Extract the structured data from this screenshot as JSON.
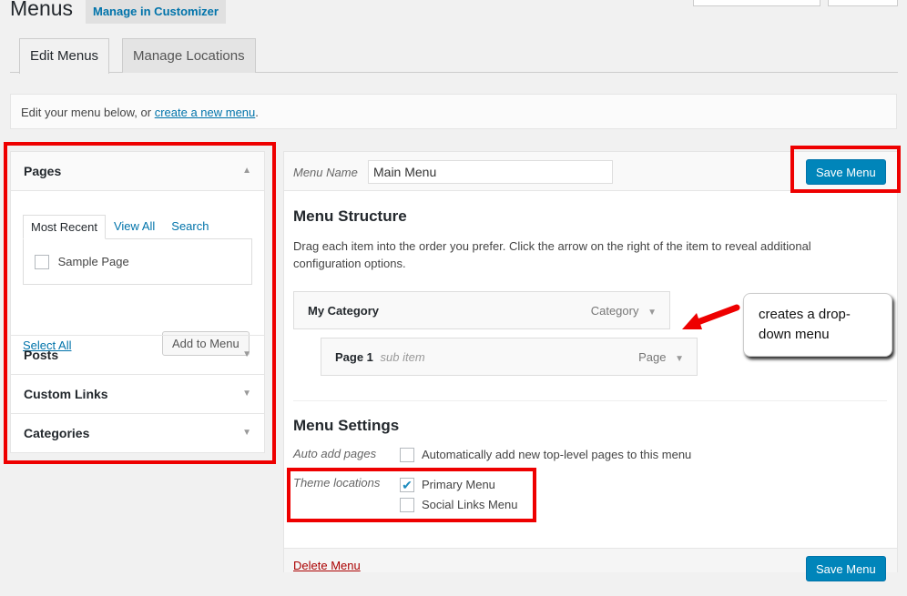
{
  "header": {
    "title": "Menus",
    "customizer_label": "Manage in Customizer"
  },
  "tabs": [
    {
      "label": "Edit Menus",
      "active": true
    },
    {
      "label": "Manage Locations",
      "active": false
    }
  ],
  "notice": {
    "text": "Edit your menu below, or ",
    "link": "create a new menu",
    "end": "."
  },
  "sidebar": {
    "pages": {
      "title": "Pages",
      "tabs": [
        "Most Recent",
        "View All",
        "Search"
      ],
      "items": [
        {
          "label": "Sample Page",
          "checked": false
        }
      ],
      "select_all": "Select All",
      "add_button": "Add to Menu"
    },
    "sections": [
      "Posts",
      "Custom Links",
      "Categories"
    ]
  },
  "menu": {
    "name_label": "Menu Name",
    "name_value": "Main Menu",
    "save_label": "Save Menu",
    "structure_title": "Menu Structure",
    "structure_desc": "Drag each item into the order you prefer. Click the arrow on the right of the item to reveal additional configuration options.",
    "items": [
      {
        "title": "My Category",
        "type": "Category"
      },
      {
        "title": "Page 1",
        "sub": "sub item",
        "type": "Page"
      }
    ],
    "settings_title": "Menu Settings",
    "auto_add_label": "Auto add pages",
    "auto_add_text": "Automatically add new top-level pages to this menu",
    "auto_add_checked": false,
    "locations_label": "Theme locations",
    "locations": [
      {
        "label": "Primary Menu",
        "checked": true
      },
      {
        "label": "Social Links Menu",
        "checked": false
      }
    ],
    "delete_label": "Delete Menu"
  },
  "annotation": {
    "text": "creates a drop-down menu"
  },
  "colors": {
    "accent": "#0085ba",
    "highlight": "#e00000"
  }
}
